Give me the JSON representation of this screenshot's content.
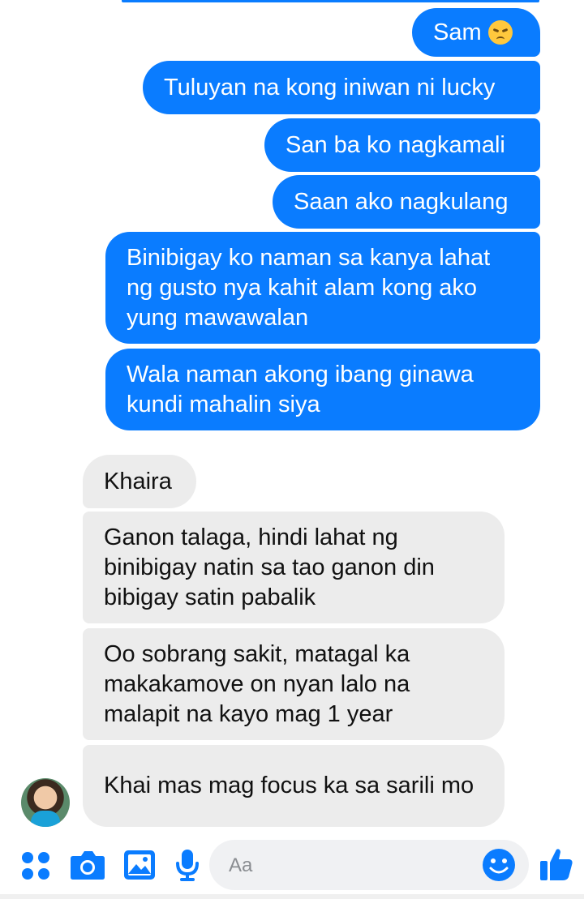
{
  "messages": {
    "outgoing": [
      "Sam",
      "Tuluyan na kong iniwan ni lucky",
      "San ba ko nagkamali",
      "Saan ako nagkulang",
      "Binibigay ko naman sa kanya lahat ng gusto nya kahit alam kong ako yung mawawalan",
      "Wala naman akong ibang ginawa kundi mahalin siya"
    ],
    "incoming": [
      "Khaira",
      "Ganon talaga, hindi lahat ng binibigay natin sa tao ganon din bibigay satin pabalik",
      "Oo sobrang sakit, matagal ka makakamove on nyan lalo na malapit na kayo mag 1 year",
      "Khai mas mag focus ka sa sarili mo"
    ]
  },
  "composer": {
    "placeholder": "Aa",
    "icons": [
      "menu-dots-icon",
      "camera-icon",
      "image-icon",
      "microphone-icon",
      "emoji-icon",
      "thumbs-up-icon"
    ]
  },
  "colors": {
    "outgoing_bubble": "#0a7cff",
    "incoming_bubble": "#ececec",
    "accent": "#0a7cff"
  }
}
